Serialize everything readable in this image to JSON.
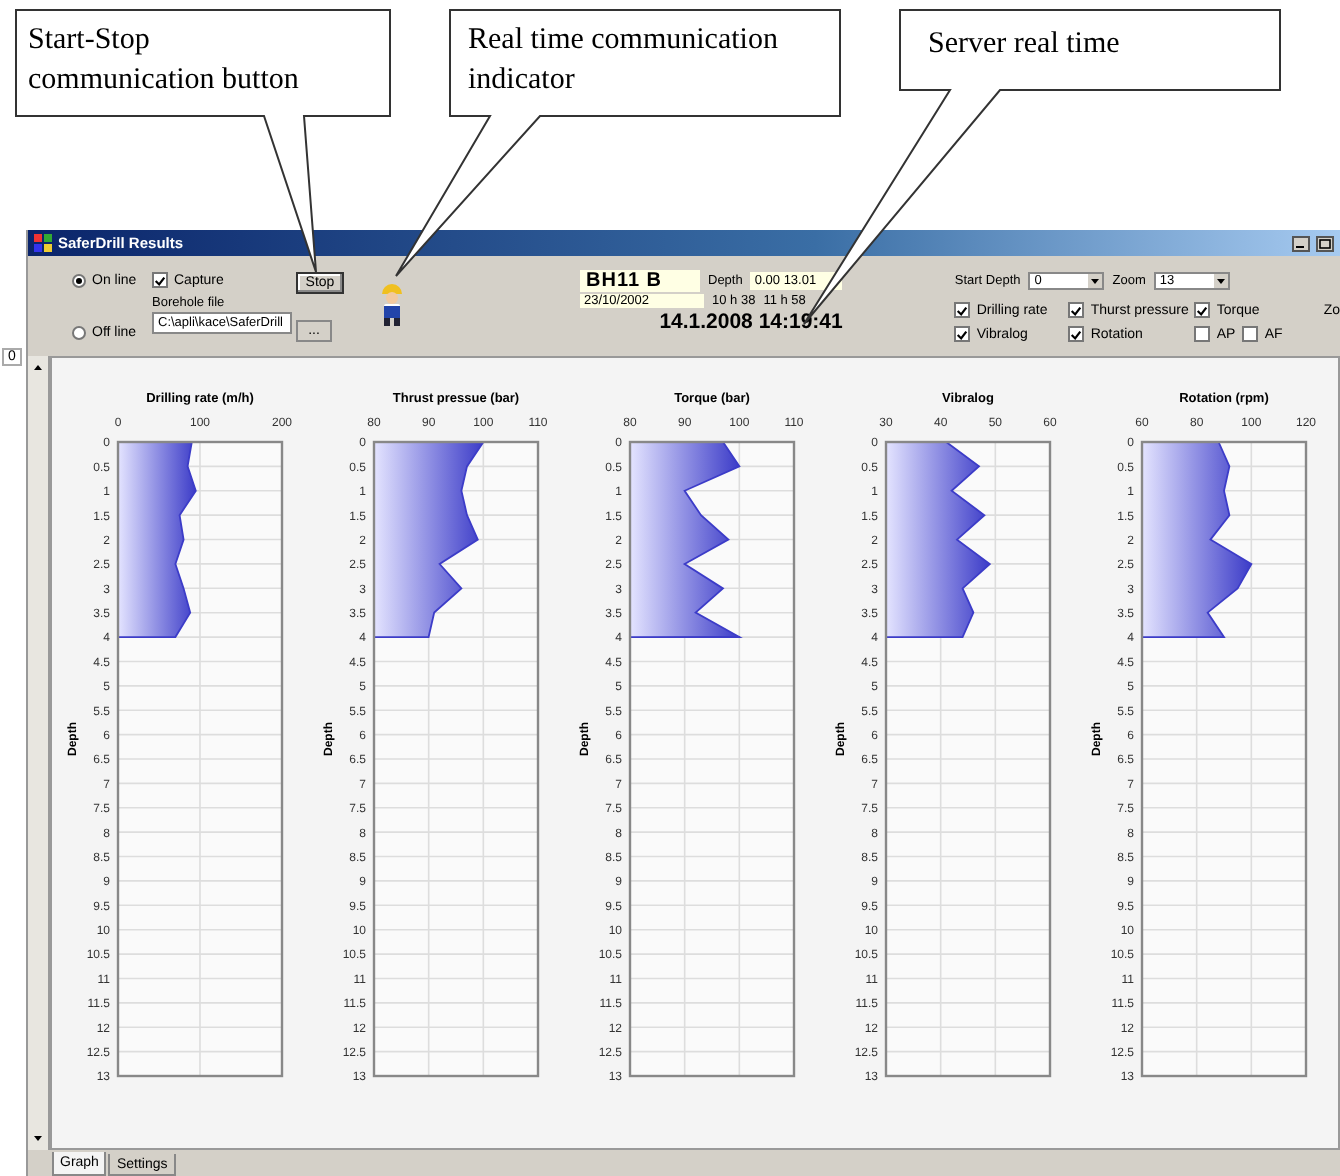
{
  "callouts": [
    {
      "lines": [
        "Start-Stop",
        "communication button"
      ]
    },
    {
      "lines": [
        "Real time communication",
        "indicator"
      ]
    },
    {
      "lines": [
        "Server real time"
      ]
    }
  ],
  "side_field": "0",
  "window": {
    "title": "SaferDrill Results"
  },
  "mode_radios": [
    {
      "label": "On line",
      "selected": true
    },
    {
      "label": "Off line",
      "selected": false
    }
  ],
  "capture": {
    "label": "Capture",
    "checked": true
  },
  "borehole_label": "Borehole file",
  "borehole_path": "C:\\apli\\kace\\SaferDrill",
  "stop_button": "Stop",
  "browse_button": "...",
  "info": {
    "borehole": "BH11 B",
    "depth_label": "Depth",
    "depth_range": "0.00 13.01",
    "date": "23/10/2002",
    "start_time": "10 h 38",
    "end_time": "11 h 58",
    "server_time": "14.1.2008 14:19:41"
  },
  "start_depth": {
    "label": "Start Depth",
    "value": "0"
  },
  "zoom": {
    "label": "Zoom",
    "value": "13"
  },
  "cut_label": "Zo",
  "series_checks": [
    {
      "label": "Drilling rate",
      "checked": true
    },
    {
      "label": "Thurst pressure",
      "checked": true
    },
    {
      "label": "Torque",
      "checked": true
    },
    {
      "label": "Vibralog",
      "checked": true
    },
    {
      "label": "Rotation",
      "checked": true
    },
    {
      "label": "AP",
      "checked": false
    },
    {
      "label": "AF",
      "checked": false
    }
  ],
  "charts": [
    {
      "axis_label": "Depth",
      "chart_data": {
        "type": "area",
        "orientation": "horizontal",
        "grid": true,
        "title": "Drilling rate (m/h)",
        "xlim": [
          0,
          200
        ],
        "xticks": [
          0,
          100,
          200
        ],
        "categories": [
          0,
          0.5,
          1,
          1.5,
          2,
          2.5,
          3,
          3.5,
          4,
          4.5,
          5,
          5.5,
          6,
          6.5,
          7,
          7.5,
          8,
          8.5,
          9,
          9.5,
          10,
          10.5,
          11,
          11.5,
          12,
          12.5,
          13
        ],
        "series": [
          {
            "color": "#3c3cc8",
            "values": [
              90,
              85,
              95,
              75,
              80,
              70,
              80,
              88,
              70,
              null,
              null,
              null,
              null,
              null,
              null,
              null,
              null,
              null,
              null,
              null,
              null,
              null,
              null,
              null,
              null,
              null,
              null
            ]
          }
        ]
      }
    },
    {
      "axis_label": "Depth",
      "chart_data": {
        "type": "area",
        "orientation": "horizontal",
        "grid": true,
        "title": "Thrust pressue (bar)",
        "xlim": [
          80,
          110
        ],
        "xticks": [
          80,
          90,
          100,
          110
        ],
        "categories": [
          0,
          0.5,
          1,
          1.5,
          2,
          2.5,
          3,
          3.5,
          4,
          4.5,
          5,
          5.5,
          6,
          6.5,
          7,
          7.5,
          8,
          8.5,
          9,
          9.5,
          10,
          10.5,
          11,
          11.5,
          12,
          12.5,
          13
        ],
        "series": [
          {
            "color": "#3c3cc8",
            "values": [
              100,
              97,
              96,
              97,
              99,
              92,
              96,
              91,
              90,
              null,
              null,
              null,
              null,
              null,
              null,
              null,
              null,
              null,
              null,
              null,
              null,
              null,
              null,
              null,
              null,
              null,
              null
            ]
          }
        ]
      }
    },
    {
      "axis_label": "Depth",
      "chart_data": {
        "type": "area",
        "orientation": "horizontal",
        "grid": true,
        "title": "Torque (bar)",
        "xlim": [
          80,
          110
        ],
        "xticks": [
          80,
          90,
          100,
          110
        ],
        "categories": [
          0,
          0.5,
          1,
          1.5,
          2,
          2.5,
          3,
          3.5,
          4,
          4.5,
          5,
          5.5,
          6,
          6.5,
          7,
          7.5,
          8,
          8.5,
          9,
          9.5,
          10,
          10.5,
          11,
          11.5,
          12,
          12.5,
          13
        ],
        "series": [
          {
            "color": "#3c3cc8",
            "values": [
              97,
              100,
              90,
              93,
              98,
              90,
              97,
              92,
              100,
              null,
              null,
              null,
              null,
              null,
              null,
              null,
              null,
              null,
              null,
              null,
              null,
              null,
              null,
              null,
              null,
              null,
              null
            ]
          }
        ]
      }
    },
    {
      "axis_label": "Depth",
      "chart_data": {
        "type": "area",
        "orientation": "horizontal",
        "grid": true,
        "title": "Vibralog",
        "xlim": [
          30,
          60
        ],
        "xticks": [
          30,
          40,
          50,
          60
        ],
        "categories": [
          0,
          0.5,
          1,
          1.5,
          2,
          2.5,
          3,
          3.5,
          4,
          4.5,
          5,
          5.5,
          6,
          6.5,
          7,
          7.5,
          8,
          8.5,
          9,
          9.5,
          10,
          10.5,
          11,
          11.5,
          12,
          12.5,
          13
        ],
        "series": [
          {
            "color": "#3c3cc8",
            "values": [
              41,
              47,
              42,
              48,
              43,
              49,
              44,
              46,
              44,
              null,
              null,
              null,
              null,
              null,
              null,
              null,
              null,
              null,
              null,
              null,
              null,
              null,
              null,
              null,
              null,
              null,
              null
            ]
          }
        ]
      }
    },
    {
      "axis_label": "Depth",
      "chart_data": {
        "type": "area",
        "orientation": "horizontal",
        "grid": true,
        "title": "Rotation (rpm)",
        "xlim": [
          60,
          120
        ],
        "xticks": [
          60,
          80,
          100,
          120
        ],
        "categories": [
          0,
          0.5,
          1,
          1.5,
          2,
          2.5,
          3,
          3.5,
          4,
          4.5,
          5,
          5.5,
          6,
          6.5,
          7,
          7.5,
          8,
          8.5,
          9,
          9.5,
          10,
          10.5,
          11,
          11.5,
          12,
          12.5,
          13
        ],
        "series": [
          {
            "color": "#3c3cc8",
            "values": [
              88,
              92,
              90,
              92,
              85,
              100,
              95,
              84,
              90,
              null,
              null,
              null,
              null,
              null,
              null,
              null,
              null,
              null,
              null,
              null,
              null,
              null,
              null,
              null,
              null,
              null,
              null
            ]
          }
        ]
      }
    }
  ],
  "tabs": [
    {
      "label": "Graph",
      "selected": true
    },
    {
      "label": "Settings",
      "selected": false
    }
  ]
}
